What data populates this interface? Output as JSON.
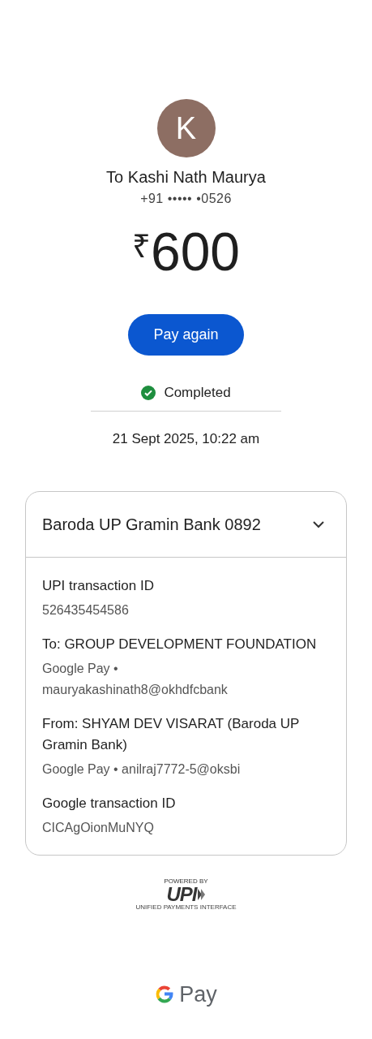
{
  "payee": {
    "initial": "K",
    "name": "To Kashi Nath Maurya",
    "phone": "+91 ••••• •0526"
  },
  "amount": {
    "currency": "₹",
    "value": "600"
  },
  "pay_again_button": "Pay again",
  "status": {
    "kind": "success",
    "label": "Completed"
  },
  "datetime": "21 Sept 2025, 10:22 am",
  "details_card": {
    "account": "Baroda UP Gramin Bank 0892",
    "fields": [
      {
        "label": "UPI transaction ID",
        "value": "526435454586"
      },
      {
        "label": "To: GROUP DEVELOPMENT FOUNDATION",
        "value": "Google Pay • mauryakashinath8@okhdfcbank"
      },
      {
        "label": "From: SHYAM DEV VISARAT (Baroda UP Gramin Bank)",
        "value": "Google Pay • anilraj7772-5@oksbi"
      },
      {
        "label": "Google transaction ID",
        "value": "CICAgOionMuNYQ"
      }
    ]
  },
  "upi_badge": {
    "caption": "POWERED BY",
    "wordmark": "UPI",
    "tagline": "UNIFIED PAYMENTS INTERFACE"
  },
  "brand": {
    "wordmark": "Pay"
  }
}
